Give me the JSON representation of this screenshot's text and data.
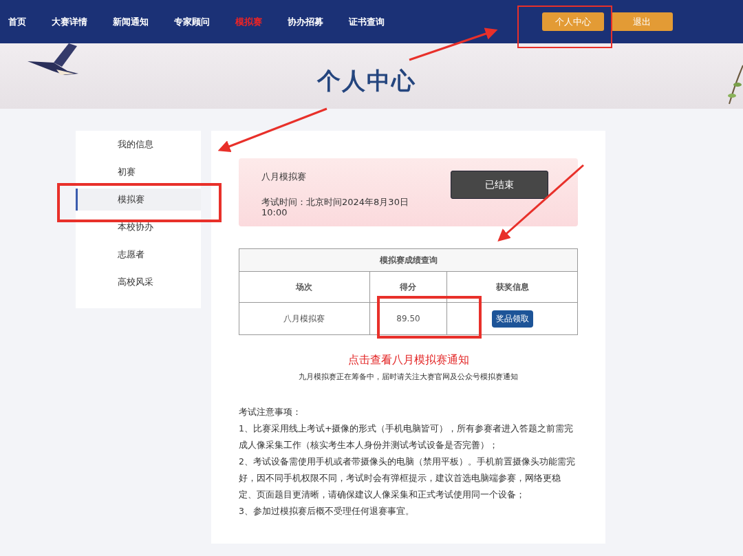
{
  "nav": {
    "items": [
      {
        "label": "首页",
        "selected": false
      },
      {
        "label": "大赛详情",
        "selected": false
      },
      {
        "label": "新闻通知",
        "selected": false
      },
      {
        "label": "专家顾问",
        "selected": false
      },
      {
        "label": "模拟赛",
        "selected": true
      },
      {
        "label": "协办招募",
        "selected": false
      },
      {
        "label": "证书查询",
        "selected": false
      }
    ],
    "buttons": [
      "个人中心",
      "退出"
    ]
  },
  "banner": {
    "title": "个人中心"
  },
  "sidebar": {
    "items": [
      {
        "label": "我的信息",
        "selected": false
      },
      {
        "label": "初赛",
        "selected": false
      },
      {
        "label": "模拟赛",
        "selected": true
      },
      {
        "label": "本校协办",
        "selected": false
      },
      {
        "label": "志愿者",
        "selected": false
      },
      {
        "label": "高校风采",
        "selected": false
      }
    ]
  },
  "exam_card": {
    "name": "八月模拟赛",
    "time": "考试时间：北京时间2024年8月30日10:00",
    "status": "已结束"
  },
  "score_table": {
    "title": "模拟赛成绩查询",
    "columns": [
      "场次",
      "得分",
      "获奖信息"
    ],
    "rows": [
      {
        "session": "八月模拟赛",
        "score": "89.50",
        "action": "奖品领取"
      }
    ]
  },
  "notice_link": "点击查看八月模拟赛通知",
  "notice_sub": "九月模拟赛正在筹备中，届时请关注大赛官网及公众号模拟赛通知",
  "rules": {
    "heading": "考试注意事项：",
    "items": [
      "1、比赛采用线上考试+摄像的形式（手机电脑皆可），所有参赛者进入答题之前需完成人像采集工作（核实考生本人身份并测试考试设备是否完善）；",
      "2、考试设备需使用手机或者带摄像头的电脑（禁用平板）。手机前置摄像头功能需完好，因不同手机权限不同，考试时会有弹框提示，建议首选电脑端参赛，网络更稳定、页面题目更清晰，请确保建议人像采集和正式考试使用同一个设备；",
      "3、参加过模拟赛后概不受理任何退赛事宜。"
    ]
  }
}
